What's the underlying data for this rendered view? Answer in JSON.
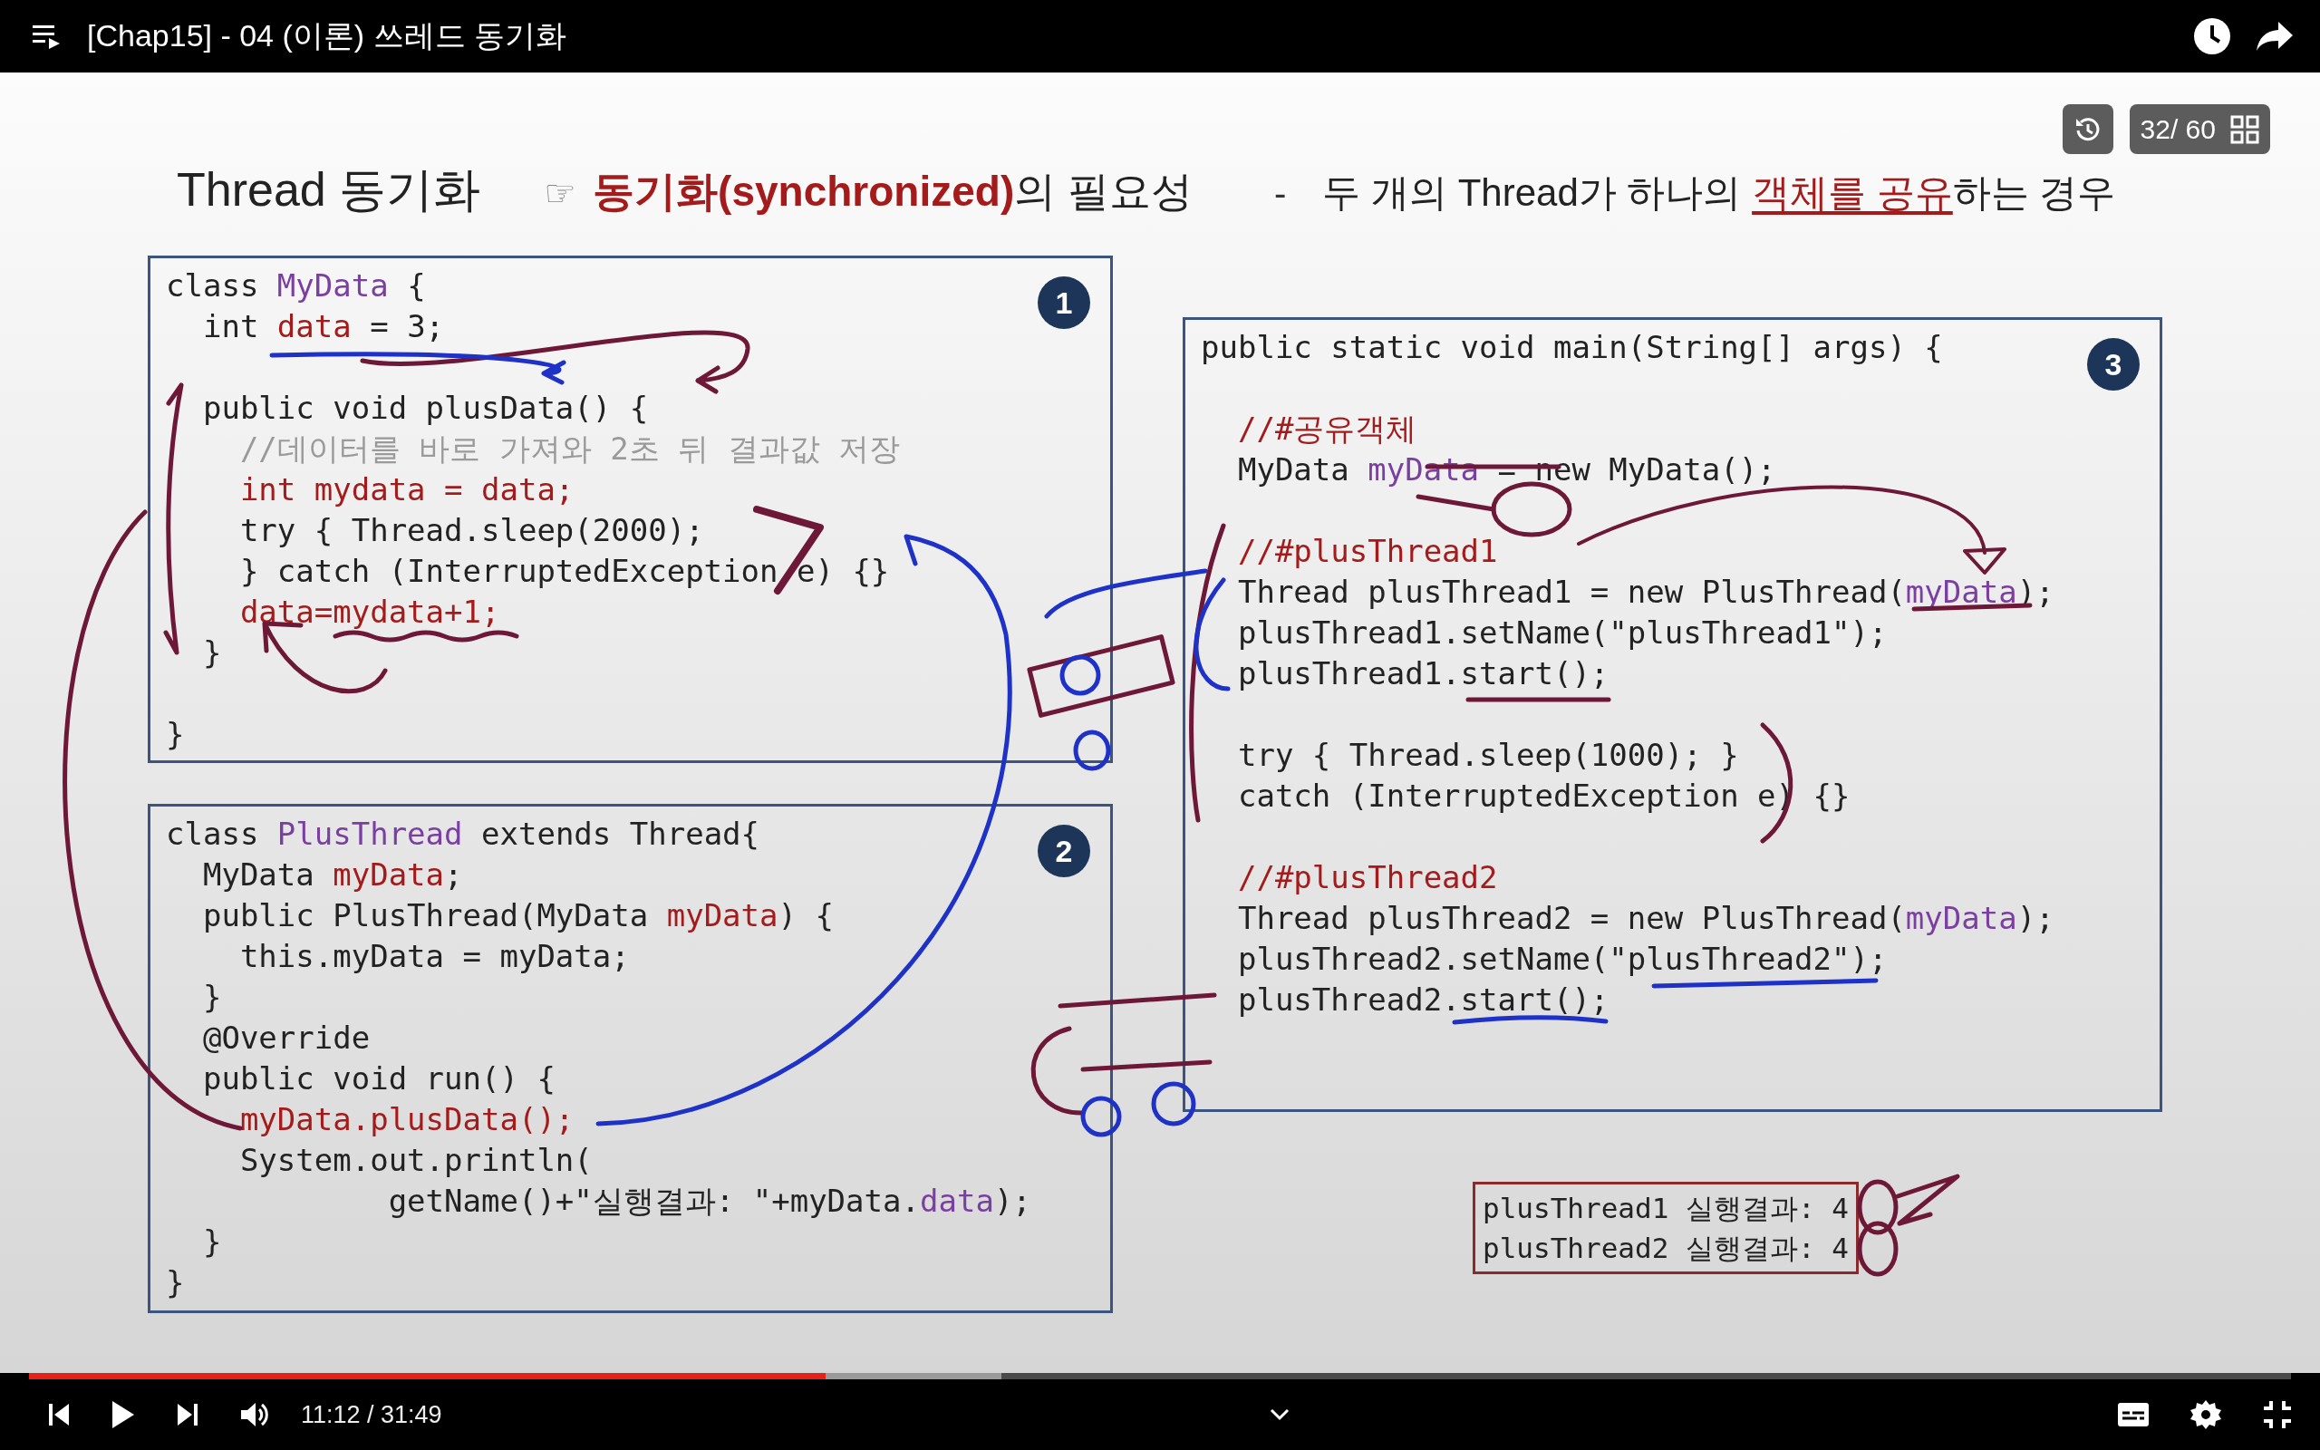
{
  "top_bar": {
    "title": "[Chap15] - 04 (이론) 쓰레드 동기화"
  },
  "slide": {
    "counter": "32/ 60",
    "heading": {
      "title": "Thread 동기화",
      "pointer": "☞",
      "topic": "**동기화(synchronized)**의 필요성",
      "dash": "-",
      "note": {
        "before": "두 개의 Thread가 하나의 ",
        "highlight": "객체를 공유",
        "after": "하는 경우"
      }
    },
    "code_boxes": [
      {
        "badge": "1",
        "lines": [
          {
            "kind": "code",
            "segments": [
              {
                "text": "class ",
                "kind": "plain"
              },
              {
                "text": "MyData",
                "kind": "type"
              },
              {
                "text": " {",
                "kind": "plain"
              }
            ]
          },
          {
            "kind": "code",
            "segments": [
              {
                "text": "  int ",
                "kind": "plain"
              },
              {
                "text": "data",
                "kind": "accent"
              },
              {
                "text": " = 3;",
                "kind": "plain"
              }
            ]
          },
          {
            "kind": "blank"
          },
          {
            "kind": "code",
            "segments": [
              {
                "text": "  public void plusData() {",
                "kind": "plain"
              }
            ]
          },
          {
            "kind": "code",
            "segments": [
              {
                "text": "    //데이터를 바로 가져와 2초 뒤 결과값 저장",
                "kind": "comment"
              }
            ]
          },
          {
            "kind": "code",
            "segments": [
              {
                "text": "    int mydata = data;",
                "kind": "accent"
              }
            ]
          },
          {
            "kind": "code",
            "segments": [
              {
                "text": "    try { Thread.sleep(2000);",
                "kind": "plain"
              }
            ]
          },
          {
            "kind": "code",
            "segments": [
              {
                "text": "    } catch (InterruptedException e) {}",
                "kind": "plain"
              }
            ]
          },
          {
            "kind": "code",
            "segments": [
              {
                "text": "    data=mydata+1;",
                "kind": "accent"
              }
            ]
          },
          {
            "kind": "code",
            "segments": [
              {
                "text": "  }",
                "kind": "plain"
              }
            ]
          },
          {
            "kind": "blank"
          },
          {
            "kind": "code",
            "segments": [
              {
                "text": "}",
                "kind": "plain"
              }
            ]
          }
        ]
      },
      {
        "badge": "2",
        "lines": [
          {
            "kind": "code",
            "segments": [
              {
                "text": "class ",
                "kind": "plain"
              },
              {
                "text": "PlusThread",
                "kind": "type"
              },
              {
                "text": " extends Thread{",
                "kind": "plain"
              }
            ]
          },
          {
            "kind": "code",
            "segments": [
              {
                "text": "  MyData ",
                "kind": "plain"
              },
              {
                "text": "myData",
                "kind": "accent"
              },
              {
                "text": ";",
                "kind": "plain"
              }
            ]
          },
          {
            "kind": "code",
            "segments": [
              {
                "text": "  public PlusThread(MyData ",
                "kind": "plain"
              },
              {
                "text": "myData",
                "kind": "accent"
              },
              {
                "text": ") {",
                "kind": "plain"
              }
            ]
          },
          {
            "kind": "code",
            "segments": [
              {
                "text": "    this.myData = myData;",
                "kind": "plain"
              }
            ]
          },
          {
            "kind": "code",
            "segments": [
              {
                "text": "  }",
                "kind": "plain"
              }
            ]
          },
          {
            "kind": "code",
            "segments": [
              {
                "text": "  @Override",
                "kind": "plain"
              }
            ]
          },
          {
            "kind": "code",
            "segments": [
              {
                "text": "  public void run() {",
                "kind": "plain"
              }
            ]
          },
          {
            "kind": "code",
            "segments": [
              {
                "text": "    myData.plusData();",
                "kind": "accent"
              }
            ]
          },
          {
            "kind": "code",
            "segments": [
              {
                "text": "    System.out.println(",
                "kind": "plain"
              }
            ]
          },
          {
            "kind": "code",
            "segments": [
              {
                "text": "            getName()+\"실행결과: \"+myData.",
                "kind": "plain"
              },
              {
                "text": "data",
                "kind": "type"
              },
              {
                "text": ");",
                "kind": "plain"
              }
            ]
          },
          {
            "kind": "code",
            "segments": [
              {
                "text": "  }",
                "kind": "plain"
              }
            ]
          },
          {
            "kind": "code",
            "segments": [
              {
                "text": "}",
                "kind": "plain"
              }
            ]
          }
        ]
      },
      {
        "badge": "3",
        "lines": [
          {
            "kind": "code",
            "segments": [
              {
                "text": "public static void main(String[] args) {",
                "kind": "plain"
              }
            ]
          },
          {
            "kind": "blank"
          },
          {
            "kind": "code",
            "segments": [
              {
                "text": "  //#공유객체",
                "kind": "accent"
              }
            ]
          },
          {
            "kind": "code",
            "segments": [
              {
                "text": "  MyData ",
                "kind": "plain"
              },
              {
                "text": "myData",
                "kind": "type"
              },
              {
                "text": " = new MyData();",
                "kind": "plain"
              }
            ]
          },
          {
            "kind": "blank"
          },
          {
            "kind": "code",
            "segments": [
              {
                "text": "  //#plusThread1",
                "kind": "accent"
              }
            ]
          },
          {
            "kind": "code",
            "segments": [
              {
                "text": "  Thread plusThread1 = new PlusThread(",
                "kind": "plain"
              },
              {
                "text": "myData",
                "kind": "type"
              },
              {
                "text": ");",
                "kind": "plain"
              }
            ]
          },
          {
            "kind": "code",
            "segments": [
              {
                "text": "  plusThread1.setName(\"plusThread1\");",
                "kind": "plain"
              }
            ]
          },
          {
            "kind": "code",
            "segments": [
              {
                "text": "  plusThread1.start();",
                "kind": "plain"
              }
            ]
          },
          {
            "kind": "blank"
          },
          {
            "kind": "code",
            "segments": [
              {
                "text": "  try { Thread.sleep(1000); }",
                "kind": "plain"
              }
            ]
          },
          {
            "kind": "code",
            "segments": [
              {
                "text": "  catch (InterruptedException e) {}",
                "kind": "plain"
              }
            ]
          },
          {
            "kind": "blank"
          },
          {
            "kind": "code",
            "segments": [
              {
                "text": "  //#plusThread2",
                "kind": "accent"
              }
            ]
          },
          {
            "kind": "code",
            "segments": [
              {
                "text": "  Thread plusThread2 = new PlusThread(",
                "kind": "plain"
              },
              {
                "text": "myData",
                "kind": "type"
              },
              {
                "text": ");",
                "kind": "plain"
              }
            ]
          },
          {
            "kind": "code",
            "segments": [
              {
                "text": "  plusThread2.setName(\"plusThread2\");",
                "kind": "plain"
              }
            ]
          },
          {
            "kind": "code",
            "segments": [
              {
                "text": "  plusThread2.start();",
                "kind": "plain"
              }
            ]
          }
        ]
      }
    ],
    "output": [
      "plusThread1 실행결과: 4",
      "plusThread2 실행결과: 4"
    ]
  },
  "player": {
    "progress": {
      "level": 0.352
    },
    "buffer": {
      "level": 0.43
    },
    "time": "11:12 / 31:49"
  }
}
